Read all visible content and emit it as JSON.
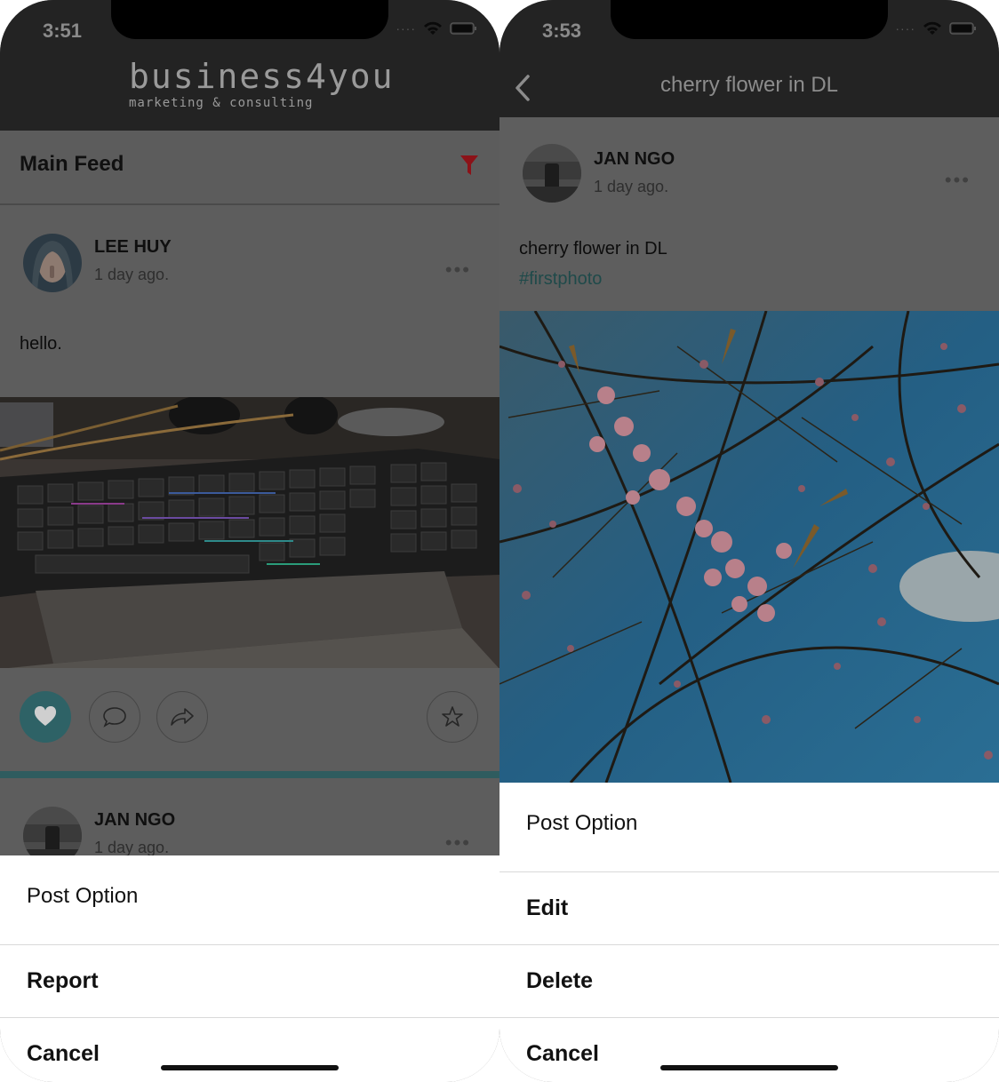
{
  "left": {
    "status": {
      "time": "3:51"
    },
    "brand": {
      "name": "business4you",
      "tagline": "marketing & consulting"
    },
    "feed": {
      "title": "Main Feed"
    },
    "post1": {
      "author": "LEE HUY",
      "time": "1 day ago.",
      "text": "hello.",
      "liked": true
    },
    "post2": {
      "author": "JAN NGO",
      "time": "1 day ago."
    },
    "sheet": {
      "title": "Post Option",
      "items": [
        "Report",
        "Cancel"
      ]
    }
  },
  "right": {
    "status": {
      "time": "3:53"
    },
    "nav": {
      "title": "cherry flower in DL"
    },
    "post": {
      "author": "JAN NGO",
      "time": "1 day ago.",
      "text": "cherry flower in DL",
      "hashtag": "#firstphoto"
    },
    "sheet": {
      "title": "Post Option",
      "items": [
        "Edit",
        "Delete",
        "Cancel"
      ]
    }
  },
  "colors": {
    "accent": "#5fb3b8",
    "filter": "#c4161c",
    "overlay": "rgba(0,0,0,0.62)"
  },
  "icons": [
    "wifi-icon",
    "battery-icon",
    "filter-icon",
    "heart-icon",
    "comment-icon",
    "share-icon",
    "star-icon",
    "more-icon",
    "back-chevron-icon"
  ]
}
